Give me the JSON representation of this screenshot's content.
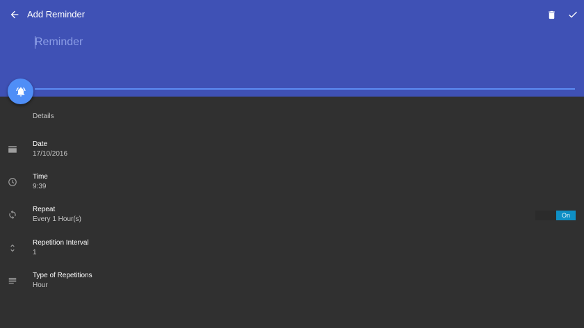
{
  "toolbar": {
    "title": "Add Reminder",
    "back_icon": "arrow-back-icon",
    "delete_icon": "trash-icon",
    "save_icon": "check-icon"
  },
  "reminder_input": {
    "placeholder": "Reminder",
    "value": ""
  },
  "fab": {
    "icon": "alarm-bell-icon"
  },
  "details": {
    "section_label": "Details",
    "rows": [
      {
        "title": "Date",
        "value": "17/10/2016",
        "icon": "calendar-icon"
      },
      {
        "title": "Time",
        "value": "9:39",
        "icon": "clock-icon"
      },
      {
        "title": "Repeat",
        "value": "Every 1 Hour(s)",
        "icon": "repeat-icon"
      },
      {
        "title": "Repetition Interval",
        "value": "1",
        "icon": "unfold-icon"
      },
      {
        "title": "Type of Repetitions",
        "value": "Hour",
        "icon": "list-icon"
      }
    ]
  },
  "repeat_toggle": {
    "label": "On",
    "state": "on"
  },
  "colors": {
    "header": "#3f51b5",
    "body": "#303030",
    "fab": "#4f8ef7",
    "toggle_on": "#0e8fc5"
  }
}
